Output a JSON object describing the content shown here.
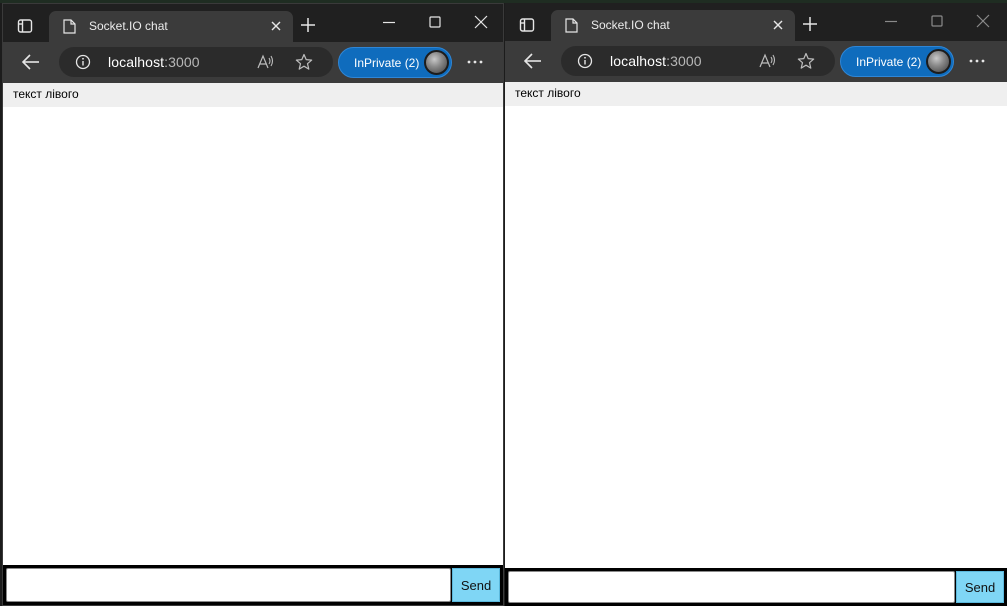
{
  "windows": [
    {
      "side": "left",
      "tab": {
        "title": "Socket.IO chat"
      },
      "address": {
        "host": "localhost",
        "port": ":3000"
      },
      "inprivate": {
        "label": "InPrivate (2)"
      },
      "messages": [
        {
          "text": "текст лівого"
        }
      ],
      "form": {
        "input_value": "",
        "send_label": "Send"
      }
    },
    {
      "side": "right",
      "tab": {
        "title": "Socket.IO chat"
      },
      "address": {
        "host": "localhost",
        "port": ":3000"
      },
      "inprivate": {
        "label": "InPrivate (2)"
      },
      "messages": [
        {
          "text": "текст лівого"
        }
      ],
      "form": {
        "input_value": "",
        "send_label": "Send"
      }
    }
  ],
  "colors": {
    "titlebar": "#202020",
    "toolbar": "#3b3b3b",
    "inprivate_badge": "#0f6cbd",
    "send_button": "#7fd6f5",
    "message_row": "#efefef"
  },
  "icons": {
    "tab_actions": "tab-actions-icon",
    "page": "page-icon",
    "close_tab": "close-icon",
    "new_tab": "plus-icon",
    "minimize": "minimize-icon",
    "maximize": "maximize-icon",
    "close_window": "close-window-icon",
    "back": "back-arrow-icon",
    "site_info": "info-icon",
    "read_aloud": "read-aloud-icon",
    "favorite": "star-icon",
    "more": "more-icon"
  }
}
